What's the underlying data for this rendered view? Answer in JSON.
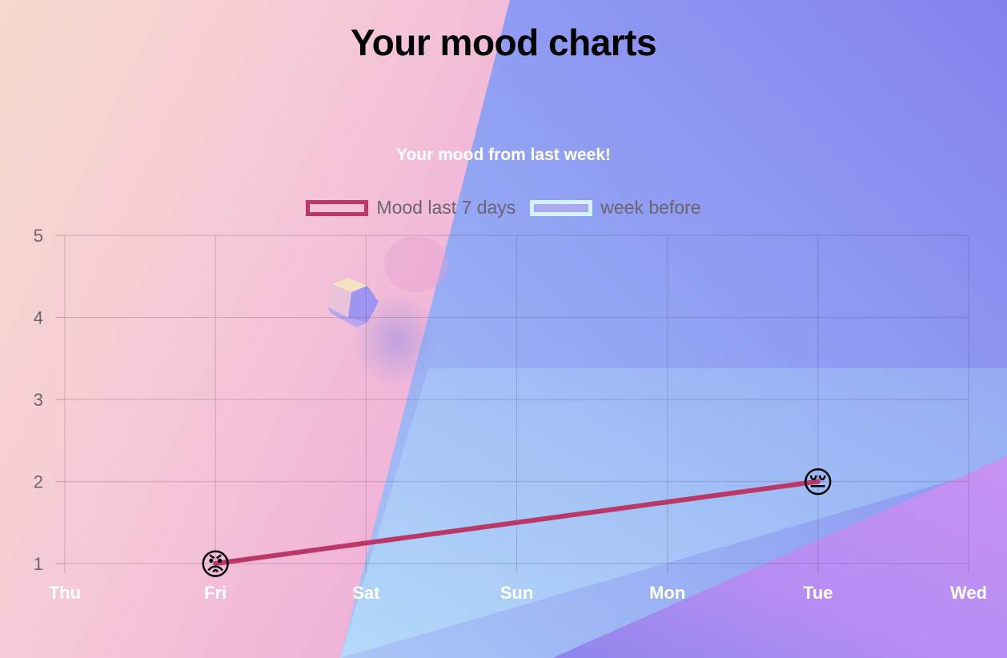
{
  "page": {
    "title": "Your mood charts"
  },
  "chart_data": {
    "type": "line",
    "title": "Your mood from last week!",
    "categories": [
      "Thu",
      "Fri",
      "Sat",
      "Sun",
      "Mon",
      "Tue",
      "Wed"
    ],
    "yticks": [
      "1",
      "2",
      "3",
      "4",
      "5"
    ],
    "ylim": [
      1,
      5
    ],
    "grid": true,
    "legend_position": "top",
    "series": [
      {
        "name": "Mood last 7 days",
        "color": "#bb3766",
        "points": [
          {
            "x": "Fri",
            "y": 1,
            "marker": "😡"
          },
          {
            "x": "Tue",
            "y": 2,
            "marker": "😔"
          }
        ]
      },
      {
        "name": "week before",
        "color": "#a9a8f0",
        "border": "#d4f3ff",
        "points": []
      }
    ]
  },
  "colors": {
    "gradient_blue": "#8c9df2",
    "gradient_purple": "#8785ee",
    "light_blue": "#b5ddf8",
    "violet": "#c28ff2"
  },
  "decor": {
    "icon": "cube-icon"
  }
}
